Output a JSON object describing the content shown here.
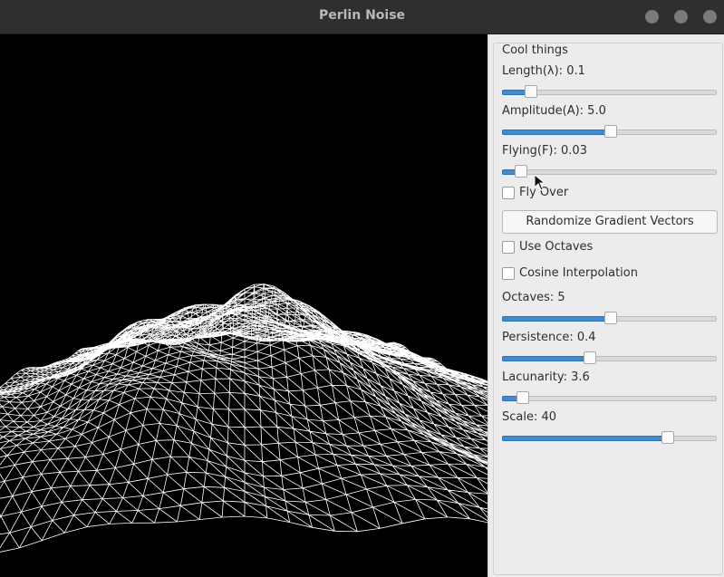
{
  "window": {
    "title": "Perlin Noise",
    "controls": [
      "minimize",
      "maximize",
      "close"
    ]
  },
  "viewport": {
    "background": "#000000",
    "wire_color": "#ffffff"
  },
  "panel": {
    "group_title": "Cool things",
    "length_label": "Length(λ): 0.1",
    "length_value": 0.11,
    "amplitude_label": "Amplitude(A): 5.0",
    "amplitude_value": 0.5,
    "flying_label": "Flying(F): 0.03",
    "flying_value": 0.06,
    "fly_over_label": "Fly Over",
    "fly_over_checked": false,
    "randomize_label": "Randomize Gradient Vectors",
    "use_octaves_label": "Use Octaves",
    "use_octaves_checked": false,
    "cosine_label": "Cosine Interpolation",
    "cosine_checked": false,
    "octaves_label": "Octaves: 5",
    "octaves_value": 0.5,
    "persistence_label": "Persistence: 0.4",
    "persistence_value": 0.4,
    "lacunarity_label": "Lacunarity: 3.6",
    "lacunarity_value": 0.07,
    "scale_label": "Scale: 40",
    "scale_value": 0.78
  },
  "colors": {
    "accent": "#3f8bcf",
    "panel_bg": "#ececec",
    "titlebar_bg": "#2f2f2f"
  }
}
